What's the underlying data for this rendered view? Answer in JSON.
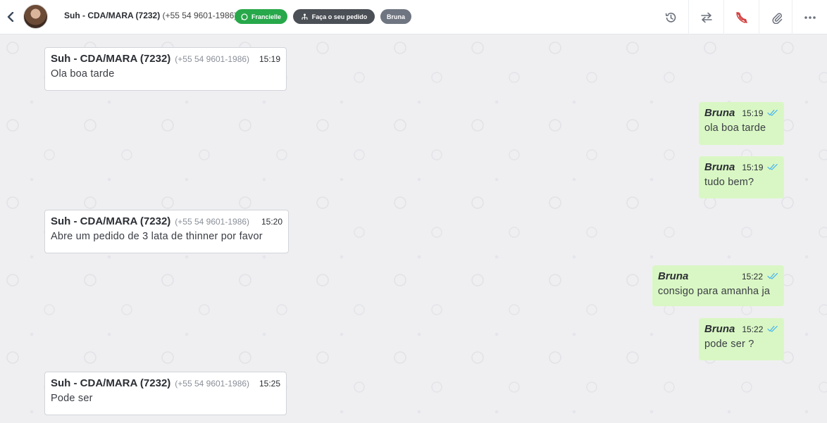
{
  "header": {
    "contact_name": "Suh - CDA/MARA (7232)",
    "contact_phone": "(+55 54 9601-1986)",
    "tags": [
      {
        "label": "Francielle",
        "color": "#27a84a",
        "icon": "whatsapp-icon"
      },
      {
        "label": "Faça o seu pedido",
        "color": "#4b4f56",
        "icon": "flow-icon"
      },
      {
        "label": "Bruna",
        "color": "#6f7681"
      }
    ],
    "actions": [
      "history-icon",
      "transfer-icon",
      "end-call-icon",
      "attach-icon",
      "more-icon"
    ],
    "accent_call_color": "#d23a3a"
  },
  "messages": [
    {
      "direction": "in",
      "sender": "Suh - CDA/MARA (7232)",
      "phone": "(+55 54 9601-1986)",
      "time": "15:19",
      "text": "Ola boa tarde"
    },
    {
      "direction": "out",
      "sender": "Bruna",
      "time": "15:19",
      "text": "ola boa tarde",
      "read": true
    },
    {
      "direction": "out",
      "sender": "Bruna",
      "time": "15:19",
      "text": "tudo bem?",
      "read": true
    },
    {
      "direction": "in",
      "sender": "Suh - CDA/MARA (7232)",
      "phone": "(+55 54 9601-1986)",
      "time": "15:20",
      "text": "Abre um pedido de 3 lata de thinner por favor"
    },
    {
      "direction": "out",
      "sender": "Bruna",
      "time": "15:22",
      "text": "consigo para amanha ja",
      "read": true
    },
    {
      "direction": "out",
      "sender": "Bruna",
      "time": "15:22",
      "text": "pode ser ?",
      "read": true
    },
    {
      "direction": "in",
      "sender": "Suh - CDA/MARA (7232)",
      "phone": "(+55 54 9601-1986)",
      "time": "15:25",
      "text": "Pode ser"
    }
  ],
  "colors": {
    "incoming_bubble": "#ffffff",
    "outgoing_bubble": "#d9f7c4",
    "read_check": "#4fb6ec",
    "chat_background": "#efeff1"
  }
}
